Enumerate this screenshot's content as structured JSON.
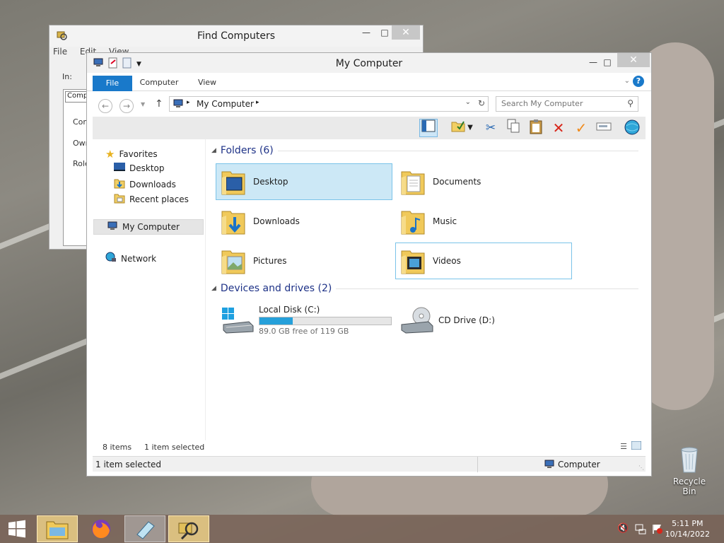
{
  "desktop": {
    "recycle_bin_label": "Recycle Bin"
  },
  "find_window": {
    "title": "Find Computers",
    "menu": [
      "File",
      "Edit",
      "View"
    ],
    "in_label": "In:",
    "tab_label": "Comp",
    "row_labels": [
      "Com",
      "Own",
      "Role"
    ]
  },
  "explorer": {
    "title": "My Computer",
    "tabs": {
      "file": "File",
      "computer": "Computer",
      "view": "View"
    },
    "address": {
      "path": "My Computer"
    },
    "search": {
      "placeholder": "Search My Computer"
    },
    "nav": {
      "favorites": "Favorites",
      "desktop": "Desktop",
      "downloads": "Downloads",
      "recent": "Recent places",
      "my_computer": "My Computer",
      "network": "Network"
    },
    "groups": {
      "folders": "Folders (6)",
      "devices": "Devices and drives (2)"
    },
    "folders": [
      "Desktop",
      "Documents",
      "Downloads",
      "Music",
      "Pictures",
      "Videos"
    ],
    "drives": [
      {
        "name": "Local Disk (C:)",
        "free": "89.0 GB free of 119 GB",
        "used_fraction": 0.25
      },
      {
        "name": "CD Drive (D:)"
      }
    ],
    "status": {
      "items": "8 items",
      "selected": "1 item selected",
      "bottom_selected": "1 item selected",
      "bottom_location": "Computer"
    }
  },
  "taskbar": {
    "time": "5:11 PM",
    "date": "10/14/2022"
  },
  "colors": {
    "accent": "#1979ca",
    "selection": "#cce8f6",
    "drive_bar": "#26a0da"
  }
}
